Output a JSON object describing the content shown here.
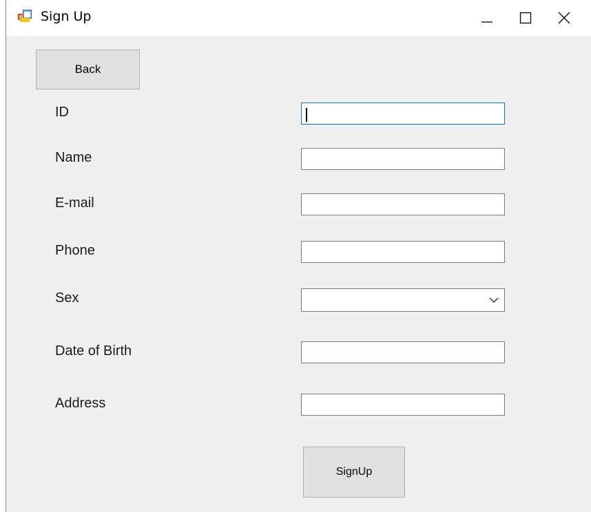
{
  "window": {
    "title": "Sign Up",
    "controls": {
      "minimize": "minimize",
      "maximize": "maximize",
      "close": "close"
    }
  },
  "buttons": {
    "back_label": "Back",
    "signup_label": "SignUp"
  },
  "form": {
    "fields": [
      {
        "label": "ID",
        "value": ""
      },
      {
        "label": "Name",
        "value": ""
      },
      {
        "label": "E-mail",
        "value": ""
      },
      {
        "label": "Phone",
        "value": ""
      },
      {
        "label": "Sex",
        "value": ""
      },
      {
        "label": "Date of Birth",
        "value": ""
      },
      {
        "label": "Address",
        "value": ""
      }
    ]
  },
  "colors": {
    "focus_border": "#0078d7",
    "window_bg": "#f0f0f0",
    "button_bg": "#e1e1e1"
  }
}
